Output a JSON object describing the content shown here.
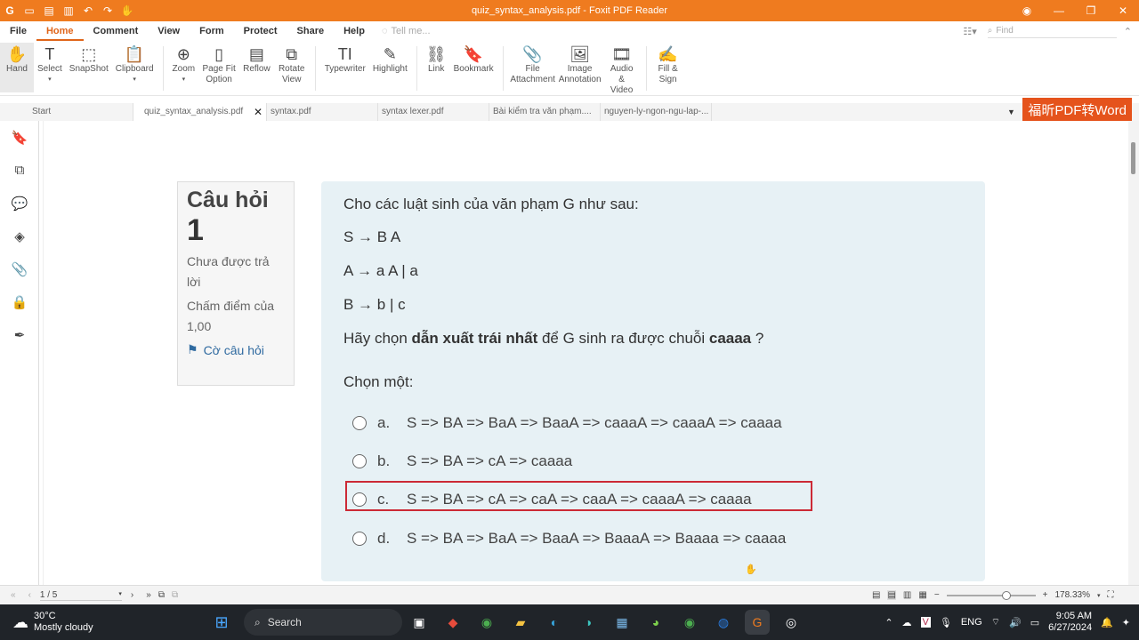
{
  "window": {
    "title": "quiz_syntax_analysis.pdf - Foxit PDF Reader"
  },
  "menu": [
    "File",
    "Home",
    "Comment",
    "View",
    "Form",
    "Protect",
    "Share",
    "Help"
  ],
  "tell_me": "Tell me...",
  "find": "Find",
  "ribbon": [
    {
      "label": "Hand",
      "icon": "hand-icon"
    },
    {
      "label": "Select",
      "icon": "select-icon"
    },
    {
      "label": "SnapShot",
      "icon": "snapshot-icon"
    },
    {
      "label": "Clipboard",
      "icon": "clipboard-icon"
    },
    {
      "label": "Zoom",
      "icon": "zoom-icon"
    },
    {
      "label": "Page Fit Option",
      "icon": "page-fit-icon"
    },
    {
      "label": "Reflow",
      "icon": "reflow-icon"
    },
    {
      "label": "Rotate View",
      "icon": "rotate-icon"
    },
    {
      "label": "Typewriter",
      "icon": "typewriter-icon"
    },
    {
      "label": "Highlight",
      "icon": "highlight-icon"
    },
    {
      "label": "Link",
      "icon": "link-icon"
    },
    {
      "label": "Bookmark",
      "icon": "bookmark-icon"
    },
    {
      "label": "File Attachment",
      "icon": "file-attachment-icon"
    },
    {
      "label": "Image Annotation",
      "icon": "image-annotation-icon"
    },
    {
      "label": "Audio & Video",
      "icon": "audio-video-icon"
    },
    {
      "label": "Fill & Sign",
      "icon": "fill-sign-icon"
    }
  ],
  "tabs": [
    "Start",
    "quiz_syntax_analysis.pdf",
    "syntax.pdf",
    "syntax lexer.pdf",
    "Bài kiểm tra văn phạm....",
    "nguyen-ly-ngon-ngu-lap-..."
  ],
  "promo": "福昕PDF转Word",
  "question": {
    "title": "Câu hỏi",
    "number": "1",
    "status": "Chưa được trả lời",
    "grade": "Chấm điểm của 1,00",
    "flag": "Cờ câu hỏi",
    "intro": "Cho các luật sinh của văn phạm G như sau:",
    "rules": [
      "S → B A",
      "A → a A | a",
      "B → b | c"
    ],
    "prompt_before": "Hãy chọn ",
    "prompt_bold": "dẫn xuất trái nhất",
    "prompt_mid": " để G sinh ra được chuỗi ",
    "prompt_bold2": "caaaa",
    "prompt_after": " ?",
    "choose": "Chọn một:",
    "options": [
      {
        "label": "a.",
        "text": "S => BA  => BaA => BaaA => caaaA => caaaA => caaaa"
      },
      {
        "label": "b.",
        "text": "S => BA => cA => caaaa"
      },
      {
        "label": "c.",
        "text": "S => BA => cA => caA => caaA => caaaA => caaaa"
      },
      {
        "label": "d.",
        "text": "S => BA  => BaA => BaaA => BaaaA => Baaaa => caaaa"
      }
    ]
  },
  "nav": {
    "page": "1 / 5",
    "zoom": "178.33%"
  },
  "taskbar": {
    "temp": "30°C",
    "weather": "Mostly cloudy",
    "search": "Search",
    "lang": "ENG",
    "time": "9:05 AM",
    "date": "6/27/2024"
  },
  "colors": {
    "accent": "#ef7b1f",
    "highlight_border": "#cc2a36",
    "question_bg": "#e7f1f5"
  }
}
